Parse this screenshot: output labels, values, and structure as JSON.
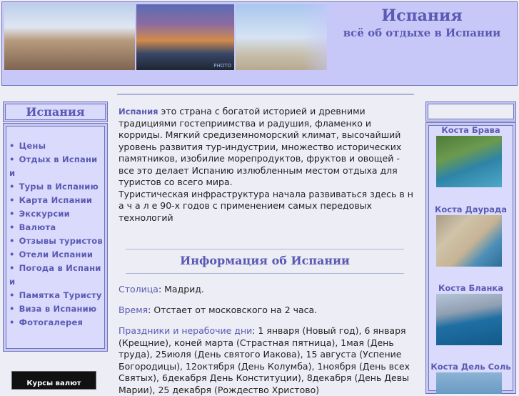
{
  "header": {
    "title": "Испания",
    "subtitle": "всё об отдыхе в Испании",
    "photo_watermark": "PHOTO"
  },
  "left": {
    "box_title": "Испания",
    "menu": [
      "Цены",
      "Отдых в Испании",
      "Туры в Испанию",
      "Карта Испании",
      "Экскурсии",
      "Валюта",
      "Отзывы туристов",
      "Отели Испании",
      "Погода в Испании",
      "Памятка Туристу",
      "Виза в Испанию",
      "Фотогалерея"
    ],
    "badge_text": "Курсы валют"
  },
  "main": {
    "intro_brand": "Испания",
    "intro_text": " это страна с богатой историей и древними традициями гостеприимства и радушия, фламенко и корриды. Мягкий средиземноморский климат, высочайший уровень развития тур-индустрии, множество исторических памятников, изобилие морепродуктов, фруктов и овощей - все это делает Испанию излюбленным местом отдыха для туристов со всего мира.",
    "intro_text2": "Туристическая инфраструктура начала развиваться здесь в н а ч а л е 90-х годов с применением самых передовых технологий",
    "section_title": "Информация об Испании",
    "info": [
      {
        "label": "Столица",
        "value": ": Мадрид."
      },
      {
        "label": "Время",
        "value": ": Отстает от московского на 2 часа."
      },
      {
        "label": "Праздники и нерабочие дни",
        "value": ": 1 января (Новый год), 6 января (Крещние), коней марта (Страстная пятница), 1мая (День труда), 25июля (День святого Иакова), 15 августа (Успение Богородицы), 12октября (День Колумба), 1ноября (День всех Святых), 6декабря День Конституции), 8декабря (День Девы Марии), 25 декабря (Рождество Христово)"
      }
    ]
  },
  "right": {
    "items": [
      "Коста Брава",
      "Коста Даурада",
      "Коста Бланка",
      "Коста Дель Соль"
    ]
  }
}
